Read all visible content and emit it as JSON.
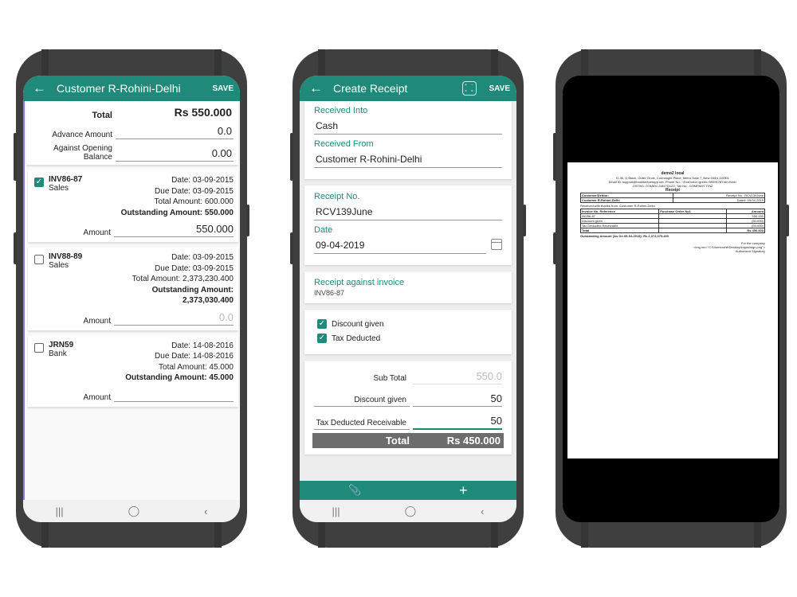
{
  "phone1": {
    "appbar": {
      "back": "←",
      "title": "Customer R-Rohini-Delhi",
      "save": "SAVE"
    },
    "total": {
      "label": "Total",
      "value": "Rs 550.000"
    },
    "advance": {
      "label": "Advance Amount",
      "value": "0.0"
    },
    "opening": {
      "label": "Against Opening Balance",
      "value": "0.00"
    },
    "invoices": [
      {
        "number": "INV86-87",
        "type": "Sales",
        "checked": true,
        "date": "Date: 03-09-2015",
        "due": "Due Date: 03-09-2015",
        "total": "Total Amount: 600.000",
        "outstanding": "Outstanding Amount: 550.000",
        "amount_label": "Amount",
        "amount": "550.000"
      },
      {
        "number": "INV88-89",
        "type": "Sales",
        "checked": false,
        "date": "Date: 03-09-2015",
        "due": "Due Date: 03-09-2015",
        "total": "Total Amount: 2,373,230.400",
        "outstanding": "Outstanding Amount: 2,373,030.400",
        "amount_label": "Amount",
        "amount": "0.0"
      },
      {
        "number": "JRN59",
        "type": "Bank",
        "checked": false,
        "date": "Date: 14-08-2016",
        "due": "Due Date: 14-08-2016",
        "total": "Total Amount: 45.000",
        "outstanding": "Outstanding Amount: 45.000",
        "amount_label": "Amount",
        "amount": ""
      }
    ],
    "nav": {
      "recent": "|||",
      "home": "◯",
      "back": "‹"
    }
  },
  "phone2": {
    "appbar": {
      "back": "←",
      "title": "Create Receipt",
      "calc": [
        "+",
        "−",
        "×",
        "="
      ],
      "save": "SAVE"
    },
    "received_into": {
      "label": "Received Into",
      "value": "Cash"
    },
    "received_from": {
      "label": "Received From",
      "value": "Customer R-Rohini-Delhi"
    },
    "receipt_no": {
      "label": "Receipt No.",
      "value": "RCV139June"
    },
    "date": {
      "label": "Date",
      "value": "09-04-2019"
    },
    "against_invoice": {
      "label": "Receipt against invoice",
      "value": "INV86-87"
    },
    "checks": [
      {
        "label": "Discount given",
        "checked": true
      },
      {
        "label": "Tax Deducted",
        "checked": true
      }
    ],
    "subtotal": {
      "label": "Sub Total",
      "value": "550.0"
    },
    "discount": {
      "label": "Discount given",
      "value": "50"
    },
    "tax": {
      "label": "Tax Deducted Receivable",
      "value": "50"
    },
    "total": {
      "label": "Total",
      "value": "Rs 450.000"
    },
    "bottom": {
      "attach": "📎",
      "add": "+"
    },
    "nav": {
      "recent": "|||",
      "home": "◯",
      "back": "‹"
    }
  },
  "phone3": {
    "document": {
      "company": "demo2 local",
      "address": "G-36, G Block, Outer Circle, Connaught Place, Metro Gate 7, New Delhi-110001",
      "contact": "Email ID: support@bookkeeperapp.net, Phone No.: <font color=green>9999178746</font>",
      "gst": "GSTIN1: 07AADCJ1847Q1Z2, Tax No.: COMPANY TIN2",
      "title": "Receipt",
      "customer_label": "Customer/Debtor:",
      "customer": "Customer R-Rohini-Delhi",
      "receipt_no": "Receipt No.: RCV139June",
      "dated": "Dated: 09-04-2019",
      "thanks": "Received with thanks from: Customer R-Rohini-Delhi",
      "headers": [
        "Invoice No. Reference",
        "Purchase Order No1",
        "Amount"
      ],
      "rows": [
        [
          "INV86-87",
          "",
          "550.000"
        ],
        [
          "Discount given",
          "",
          "(50.000)"
        ],
        [
          "Tax Deducted Receivable",
          "",
          "(50.000)"
        ]
      ],
      "total_label": "Total",
      "total_value": "Rs 450.000",
      "outstanding": "Outstanding Amount (As On 09-04-2019): Rs 2,372,075.400",
      "for_company": "For the company",
      "img_tag": "<img src=\"C:\\Users\\rohit\\Desktop\\logos\\sign.png\">",
      "signatory": "Authorized Signatory"
    }
  }
}
